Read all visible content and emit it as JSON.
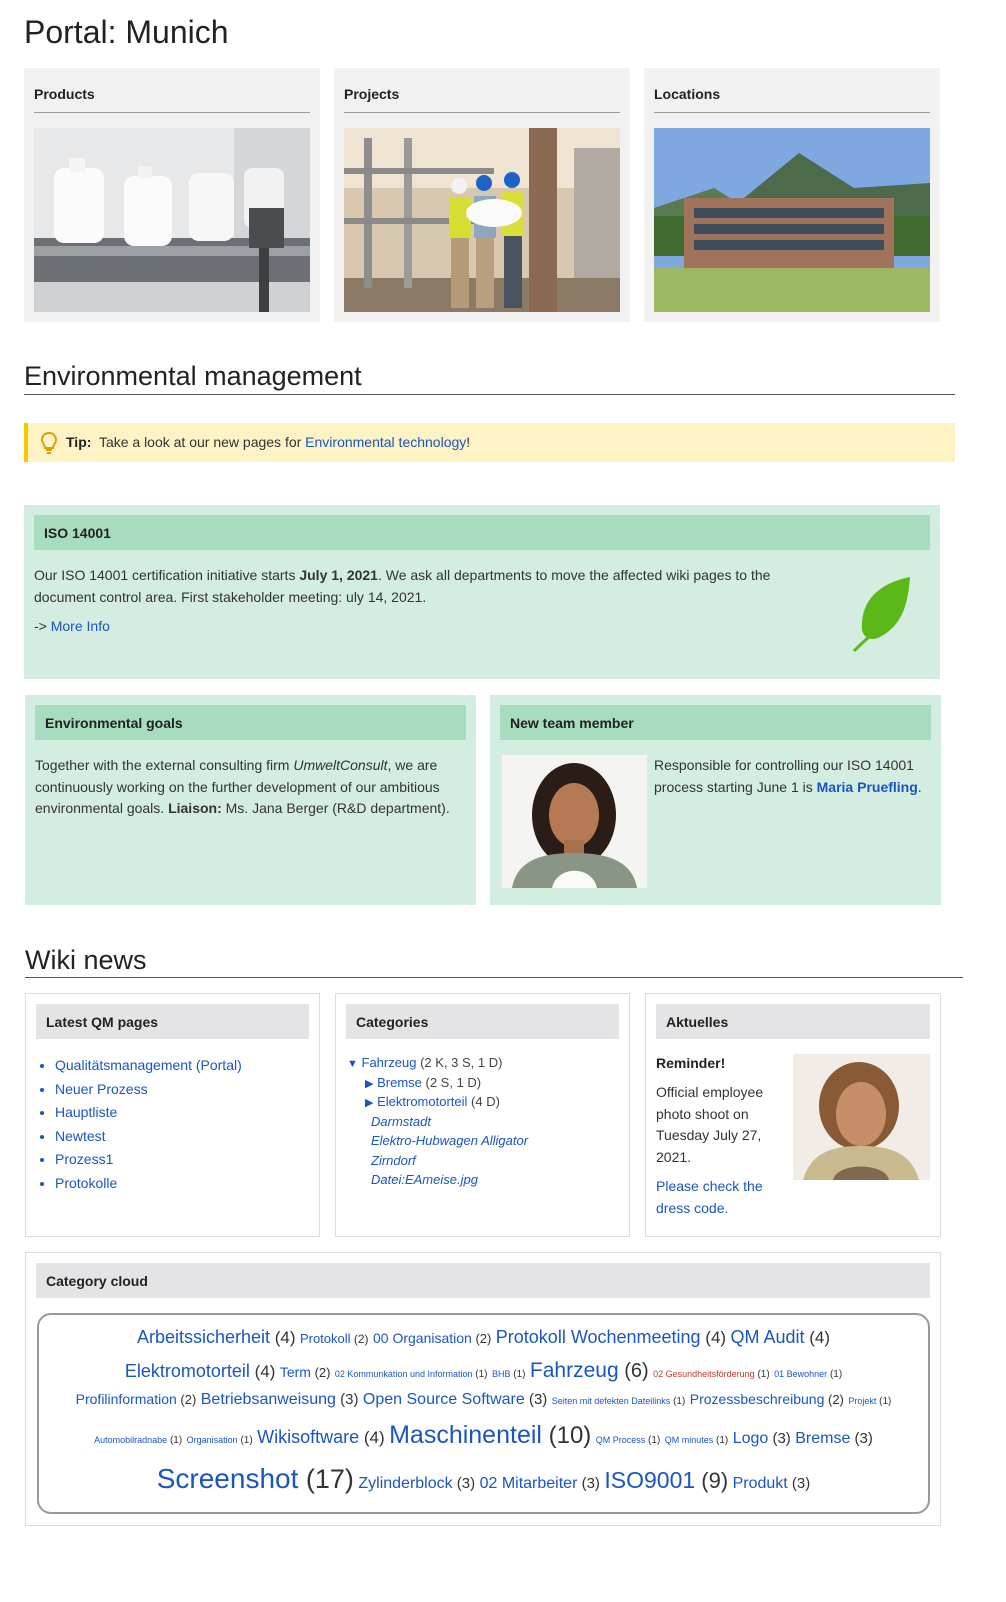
{
  "page": {
    "title": "Portal: Munich"
  },
  "portal_cards": [
    {
      "title": "Products"
    },
    {
      "title": "Projects"
    },
    {
      "title": "Locations"
    }
  ],
  "env": {
    "heading": "Environmental management",
    "tip": {
      "label": "Tip:",
      "text": "Take a look at our new pages for ",
      "link": "Environmental technology",
      "suffix": "!"
    },
    "iso": {
      "title": "ISO 14001",
      "text1": "Our ISO 14001 certification initiative starts ",
      "date": "July 1, 2021",
      "text2": ". We ask all departments to move the affected wiki pages to the document control area. First stakeholder meeting: uly 14, 2021.",
      "more_prefix": "-> ",
      "more_link": "More Info"
    },
    "goals": {
      "title": "Environmental goals",
      "t1": "Together with the external consulting firm ",
      "firm": "UmweltConsult",
      "t2": ", we are continuously working on the further development of our ambitious environmental goals. ",
      "liaison_label": "Liaison:",
      "t3": " Ms. Jana Berger (R&D department)."
    },
    "member": {
      "title": "New team member",
      "text": "Responsible for controlling our ISO 14001 process starting June 1 is ",
      "link": "Maria Pruefling",
      "suffix": "."
    }
  },
  "news": {
    "heading": "Wiki news",
    "latest": {
      "title": "Latest QM pages",
      "items": [
        "Qualitätsmanagement (Portal)",
        "Neuer Prozess",
        "Hauptliste",
        "Newtest",
        "Prozess1",
        "Protokolle"
      ]
    },
    "categories": {
      "title": "Categories",
      "fahrzeug": "Fahrzeug",
      "fahrzeug_count": "(2 K, 3 S, 1 D)",
      "bremse": "Bremse",
      "bremse_count": "(2 S, 1 D)",
      "elektro": "Elektromotorteil",
      "elektro_count": "(4 D)",
      "pages": [
        "Darmstadt",
        "Elektro-Hubwagen Alligator",
        "Zirndorf",
        "Datei:EAmeise.jpg"
      ]
    },
    "aktuelles": {
      "title": "Aktuelles",
      "reminder": "Reminder!",
      "text": "Official employee photo shoot on Tuesday July 27, 2021.",
      "link": "Please check the dress code."
    }
  },
  "cloud": {
    "title": "Category cloud",
    "rows": [
      [
        [
          "Arbeitssicherheit",
          "(4)",
          18
        ],
        [
          "Protokoll",
          "(2)",
          13
        ],
        [
          "00 Organisation",
          "(2)",
          14
        ],
        [
          "Protokoll Wochenmeeting",
          "(4)",
          18
        ],
        [
          "QM Audit",
          "(4)",
          18
        ]
      ],
      [
        [
          "Elektromotorteil",
          "(4)",
          18
        ],
        [
          "Term",
          "(2)",
          14
        ],
        [
          "02 Kommunkation und Information",
          "(1)",
          9
        ],
        [
          "BHB",
          "(1)",
          9
        ],
        [
          "Fahrzeug",
          "(6)",
          21
        ],
        [
          "02 Gesundheitsförderung",
          "(1)",
          9,
          "red"
        ],
        [
          "01 Bewohner",
          "(1)",
          9
        ]
      ],
      [
        [
          "Profilinformation",
          "(2)",
          14
        ],
        [
          "Betriebsanweisung",
          "(3)",
          16
        ],
        [
          "Open Source Software",
          "(3)",
          16
        ],
        [
          "Seiten mit defekten Dateilinks",
          "(1)",
          9
        ],
        [
          "Prozessbeschreibung",
          "(2)",
          14
        ],
        [
          "Projekt",
          "(1)",
          9
        ]
      ],
      [
        [
          "Automobilradnabe",
          "(1)",
          9
        ],
        [
          "Organisation",
          "(1)",
          9
        ],
        [
          "Wikisoftware",
          "(4)",
          18
        ],
        [
          "Maschinenteil",
          "(10)",
          25
        ],
        [
          "QM Process",
          "(1)",
          9
        ],
        [
          "QM minutes",
          "(1)",
          9
        ],
        [
          "Logo",
          "(3)",
          16
        ],
        [
          "Bremse",
          "(3)",
          16
        ]
      ],
      [
        [
          "Screenshot",
          "(17)",
          28
        ],
        [
          "Zylinderblock",
          "(3)",
          16
        ],
        [
          "02 Mitarbeiter",
          "(3)",
          16
        ],
        [
          "ISO9001",
          "(9)",
          23
        ],
        [
          "Produkt",
          "(3)",
          16
        ]
      ]
    ]
  },
  "icons": [
    "lightbulb-icon",
    "leaf-icon",
    "triangle-down-icon",
    "triangle-right-icon"
  ],
  "colors": {
    "link": "#1a55c4",
    "green_bg": "#d3ede0",
    "green_head": "#a8dcbf",
    "tip_bg": "#fdf3c4",
    "tip_border": "#f5c800",
    "leaf": "#5cb819"
  }
}
